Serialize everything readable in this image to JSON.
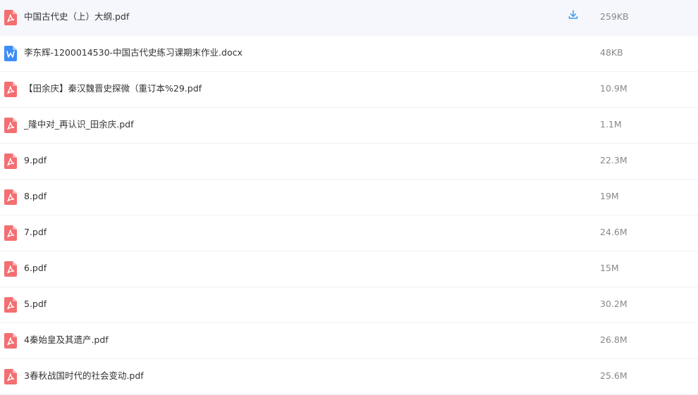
{
  "colors": {
    "pdf_icon": "#f46f72",
    "docx_icon": "#3d8ef8",
    "download_icon": "#3b9bf0",
    "row_hover": "#f5f7fc",
    "size_text": "#888888"
  },
  "files": [
    {
      "name": "中国古代史（上）大纲.pdf",
      "size": "259KB",
      "type_icon": "pdf-icon",
      "download_icon": "download-icon"
    },
    {
      "name": "李东辉-1200014530-中国古代史练习课期末作业.docx",
      "size": "48KB",
      "type_icon": "word-icon"
    },
    {
      "name": "【田余庆】秦汉魏晋史探微（重订本%29.pdf",
      "size": "10.9M",
      "type_icon": "pdf-icon"
    },
    {
      "name": "_隆中对_再认识_田余庆.pdf",
      "size": "1.1M",
      "type_icon": "pdf-icon"
    },
    {
      "name": "9.pdf",
      "size": "22.3M",
      "type_icon": "pdf-icon"
    },
    {
      "name": "8.pdf",
      "size": "19M",
      "type_icon": "pdf-icon"
    },
    {
      "name": "7.pdf",
      "size": "24.6M",
      "type_icon": "pdf-icon"
    },
    {
      "name": "6.pdf",
      "size": "15M",
      "type_icon": "pdf-icon"
    },
    {
      "name": "5.pdf",
      "size": "30.2M",
      "type_icon": "pdf-icon"
    },
    {
      "name": "4秦始皇及其遗产.pdf",
      "size": "26.8M",
      "type_icon": "pdf-icon"
    },
    {
      "name": "3春秋战国时代的社会变动.pdf",
      "size": "25.6M",
      "type_icon": "pdf-icon"
    }
  ]
}
